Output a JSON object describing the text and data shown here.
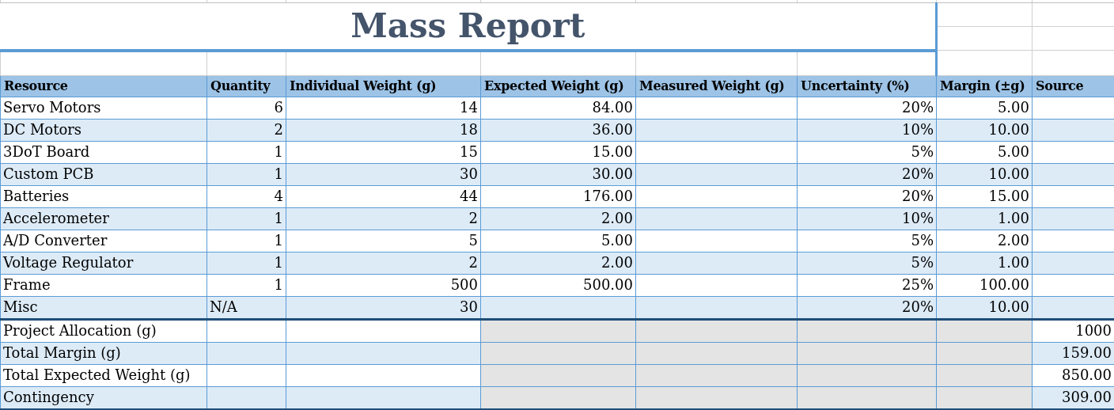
{
  "title": "Mass Report",
  "columns": [
    "Resource",
    "Quantity",
    "Individual Weight (g)",
    "Expected Weight (g)",
    "Measured Weight (g)",
    "Uncertainty (%)",
    "Margin (±g)",
    "Source"
  ],
  "rows": [
    {
      "cells": [
        "Servo Motors",
        "6",
        "14",
        "84.00",
        null,
        "20%",
        "5.00",
        null
      ]
    },
    {
      "cells": [
        "DC Motors",
        "2",
        "18",
        "36.00",
        null,
        "10%",
        "10.00",
        null
      ]
    },
    {
      "cells": [
        "3DoT Board",
        "1",
        "15",
        "15.00",
        null,
        "5%",
        "5.00",
        null
      ]
    },
    {
      "cells": [
        "Custom PCB",
        "1",
        "30",
        "30.00",
        null,
        "20%",
        "10.00",
        null
      ]
    },
    {
      "cells": [
        "Batteries",
        "4",
        "44",
        "176.00",
        null,
        "20%",
        "15.00",
        null
      ]
    },
    {
      "cells": [
        "Accelerometer",
        "1",
        "2",
        "2.00",
        null,
        "10%",
        "1.00",
        null
      ]
    },
    {
      "cells": [
        "A/D Converter",
        "1",
        "5",
        "5.00",
        null,
        "5%",
        "2.00",
        null
      ]
    },
    {
      "cells": [
        "Voltage Regulator",
        "1",
        "2",
        "2.00",
        null,
        "5%",
        "1.00",
        null
      ]
    },
    {
      "cells": [
        "Frame",
        "1",
        "500",
        "500.00",
        null,
        "25%",
        "100.00",
        null
      ]
    },
    {
      "cells": [
        "Misc",
        {
          "text": "N/A",
          "kind": "text"
        },
        "30",
        null,
        null,
        "20%",
        "10.00",
        null
      ]
    }
  ],
  "summary": [
    {
      "label": "Project Allocation (g)",
      "value": "1000"
    },
    {
      "label": "Total Margin (g)",
      "value": "159.00"
    },
    {
      "label": "Total Expected Weight (g)",
      "value": "850.00"
    },
    {
      "label": "Contingency",
      "value": "309.00"
    }
  ]
}
